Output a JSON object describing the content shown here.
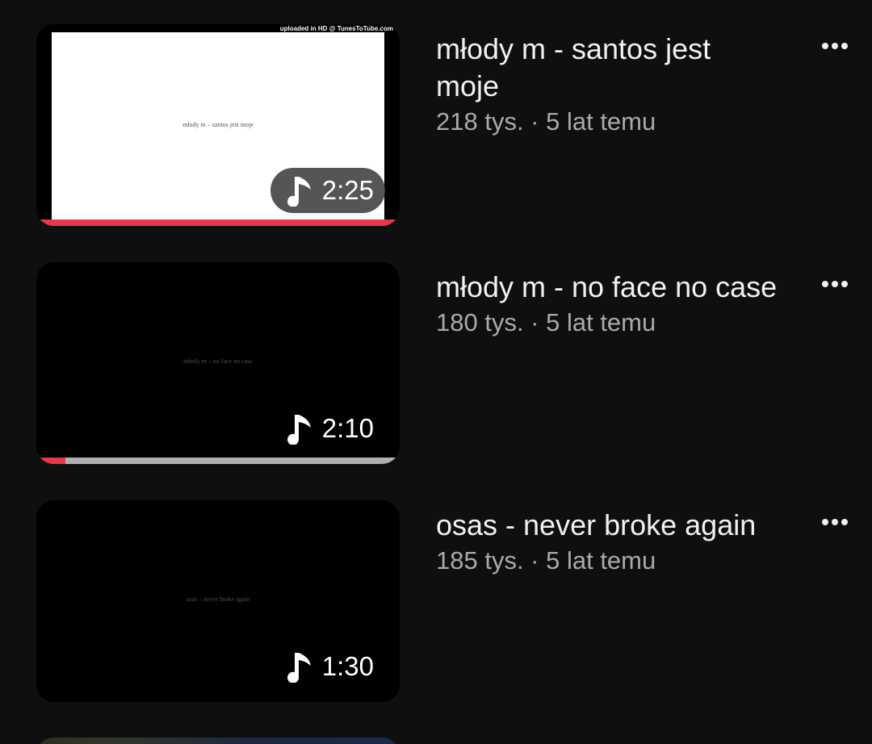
{
  "videos": [
    {
      "title": "młody m - santos jest moje",
      "meta": "218 tys. · 5 lat temu",
      "duration": "2:25",
      "thumb_caption": "młody m – santos jest moje",
      "watermark": "uploaded in HD @ TunesToTube.com",
      "progress_fraction": 1.0,
      "icon": "music-note-icon"
    },
    {
      "title": "młody m - no face no case",
      "meta": "180 tys. · 5 lat temu",
      "duration": "2:10",
      "thumb_caption": "młody m – no face no case",
      "progress_fraction": 0.08,
      "icon": "music-note-icon"
    },
    {
      "title": "osas - never broke again",
      "meta": "185 tys. · 5 lat temu",
      "duration": "1:30",
      "thumb_caption": "osas – never broke again",
      "icon": "music-note-icon"
    }
  ],
  "colors": {
    "background": "#0f0f0f",
    "progress_watched": "#e8364a",
    "progress_track": "#b0b0b0",
    "secondary_text": "#aaaaaa"
  },
  "more_icon": "more-vert-icon"
}
